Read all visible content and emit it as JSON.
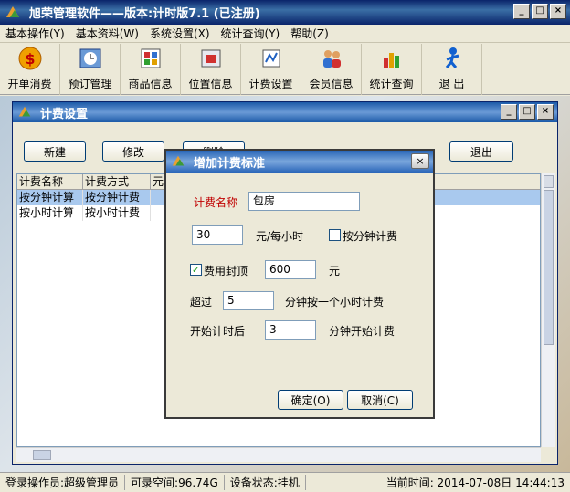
{
  "app": {
    "title": "旭荣管理软件——版本:计时版7.1 (已注册)"
  },
  "menu": [
    "基本操作(Y)",
    "基本资料(W)",
    "系统设置(X)",
    "统计查询(Y)",
    "帮助(Z)"
  ],
  "toolbar": [
    {
      "label": "开单消费",
      "icon": "coin-icon"
    },
    {
      "label": "预订管理",
      "icon": "clock-icon"
    },
    {
      "label": "商品信息",
      "icon": "grid-icon"
    },
    {
      "label": "位置信息",
      "icon": "map-icon"
    },
    {
      "label": "计费设置",
      "icon": "billing-icon"
    },
    {
      "label": "会员信息",
      "icon": "members-icon"
    },
    {
      "label": "统计查询",
      "icon": "chart-icon"
    },
    {
      "label": "退 出",
      "icon": "exit-icon"
    }
  ],
  "inner_window": {
    "title": "计费设置",
    "buttons": {
      "new": "新建",
      "edit": "修改",
      "delete": "删除",
      "exit": "退出"
    },
    "columns": [
      "计费名称",
      "计费方式",
      "元"
    ],
    "rows": [
      [
        "按分钟计算",
        "按分钟计费"
      ],
      [
        "按小时计算",
        "按小时计费"
      ]
    ]
  },
  "dialog": {
    "title": "增加计费标准",
    "name_label": "计费名称",
    "name_value": "包房",
    "price_value": "30",
    "price_unit": "元/每小时",
    "by_minute_label": "按分钟计费",
    "cap_label": "费用封顶",
    "cap_value": "600",
    "cap_unit": "元",
    "exceed_label": "超过",
    "exceed_value": "5",
    "exceed_suffix": "分钟按一个小时计费",
    "start_label": "开始计时后",
    "start_value": "3",
    "start_suffix": "分钟开始计费",
    "ok_label": "确定(O)",
    "cancel_label": "取消(C)"
  },
  "status": {
    "operator": "登录操作员:超级管理员",
    "space": "可录空间:96.74G",
    "device": "设备状态:挂机",
    "time": "当前时间: 2014-07-08日 14:44:13"
  },
  "colors": {
    "title_blue": "#0a246a",
    "selection": "#a9c9ee",
    "label_red": "#c00000"
  }
}
